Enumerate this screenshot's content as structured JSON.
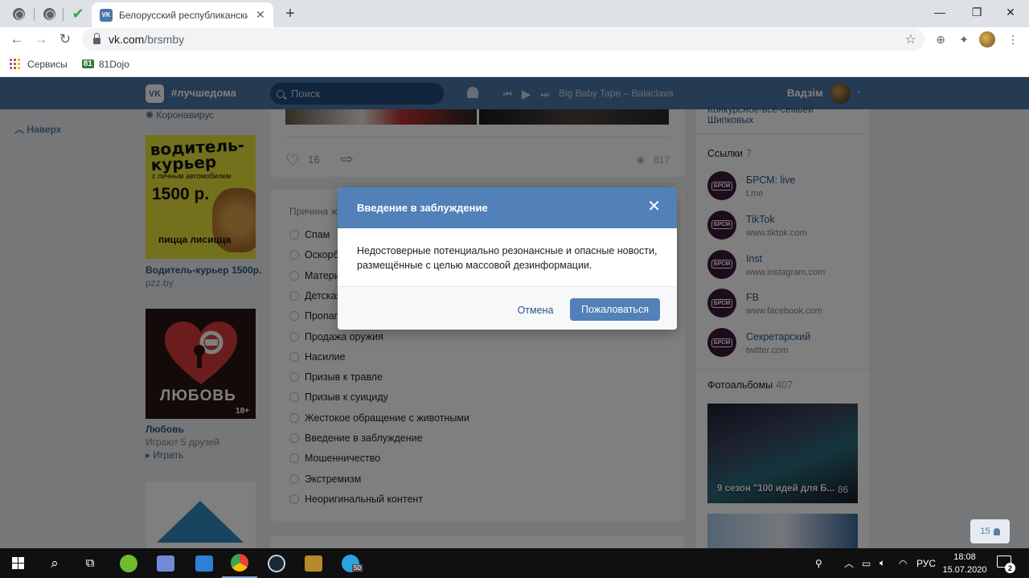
{
  "browser": {
    "tab_title": "Белорусский республиканский",
    "url_domain": "vk.com",
    "url_path": "/brsmby",
    "bookmarks": [
      {
        "label": "Сервисы",
        "icon": "apps-grid-icon"
      },
      {
        "label": "81Dojo",
        "icon": "dojo-icon",
        "badge": "81"
      }
    ]
  },
  "vk_header": {
    "logo": "VK",
    "hashtag": "#лучшедома",
    "search_placeholder": "Поиск",
    "track": "Big Baby Tape – Balaclava",
    "user_name": "Вадзім"
  },
  "page": {
    "back_to_top": "Наверх",
    "left": {
      "corona_link": "Коронавирус",
      "ad1": {
        "image_text_main": "водитель-курьер",
        "image_text_small": "с личным автомобилем",
        "image_price": "1500 р.",
        "image_brand": "пицца лисицца",
        "title": "Водитель-курьер 1500р.",
        "domain": "pzz.by"
      },
      "game": {
        "image_text": "ЛЮБОВЬ",
        "age_badge": "18+",
        "title": "Любовь",
        "friends_playing": "Играют 5 друзей",
        "play_label": "▸ Играть"
      }
    },
    "post": {
      "likes": "16",
      "views": "817"
    },
    "report": {
      "heading": "Причина жалобы",
      "reasons": [
        "Спам",
        "Оскорбление",
        "Материал для взрослых",
        "Детская порнография",
        "Пропаганда наркотиков",
        "Продажа оружия",
        "Насилие",
        "Призыв к травле",
        "Призыв к суициду",
        "Жестокое обращение с животными",
        "Введение в заблуждение",
        "Мошенничество",
        "Экстремизм",
        "Неоригинальный контент"
      ]
    },
    "right": {
      "top_text_line1": "Конкурсное-всё-семьёй",
      "top_text_line2": "Шипковых",
      "links_heading": "Ссылки",
      "links_count": "7",
      "links": [
        {
          "name": "БРСМ: live",
          "url": "t.me",
          "badge": "БРСМ"
        },
        {
          "name": "TikTok",
          "url": "www.tiktok.com",
          "badge": "БРСМ"
        },
        {
          "name": "Inst",
          "url": "www.instagram.com",
          "badge": "БРСМ"
        },
        {
          "name": "FB",
          "url": "www.facebook.com",
          "badge": "БРСМ"
        },
        {
          "name": "Секретарский",
          "url": "twitter.com",
          "badge": "БРСМ"
        }
      ],
      "albums_heading": "Фотоальбомы",
      "albums_count": "407",
      "album1_caption": "9 сезон \"100 идей для Б...",
      "album1_count": "86"
    },
    "online_count": "15"
  },
  "modal": {
    "title": "Введение в заблуждение",
    "body": "Недостоверные потенциально резонансные и опасные новости, размещённые с целью массовой дезинформации.",
    "cancel_label": "Отмена",
    "submit_label": "Пожаловаться"
  },
  "taskbar": {
    "language": "РУС",
    "time": "18:08",
    "date": "15.07.2020",
    "notifications": "2",
    "telegram_badge": "50"
  },
  "colors": {
    "vk_header": "#4a76a8",
    "vk_button": "#5181b8",
    "link": "#2a5885"
  }
}
